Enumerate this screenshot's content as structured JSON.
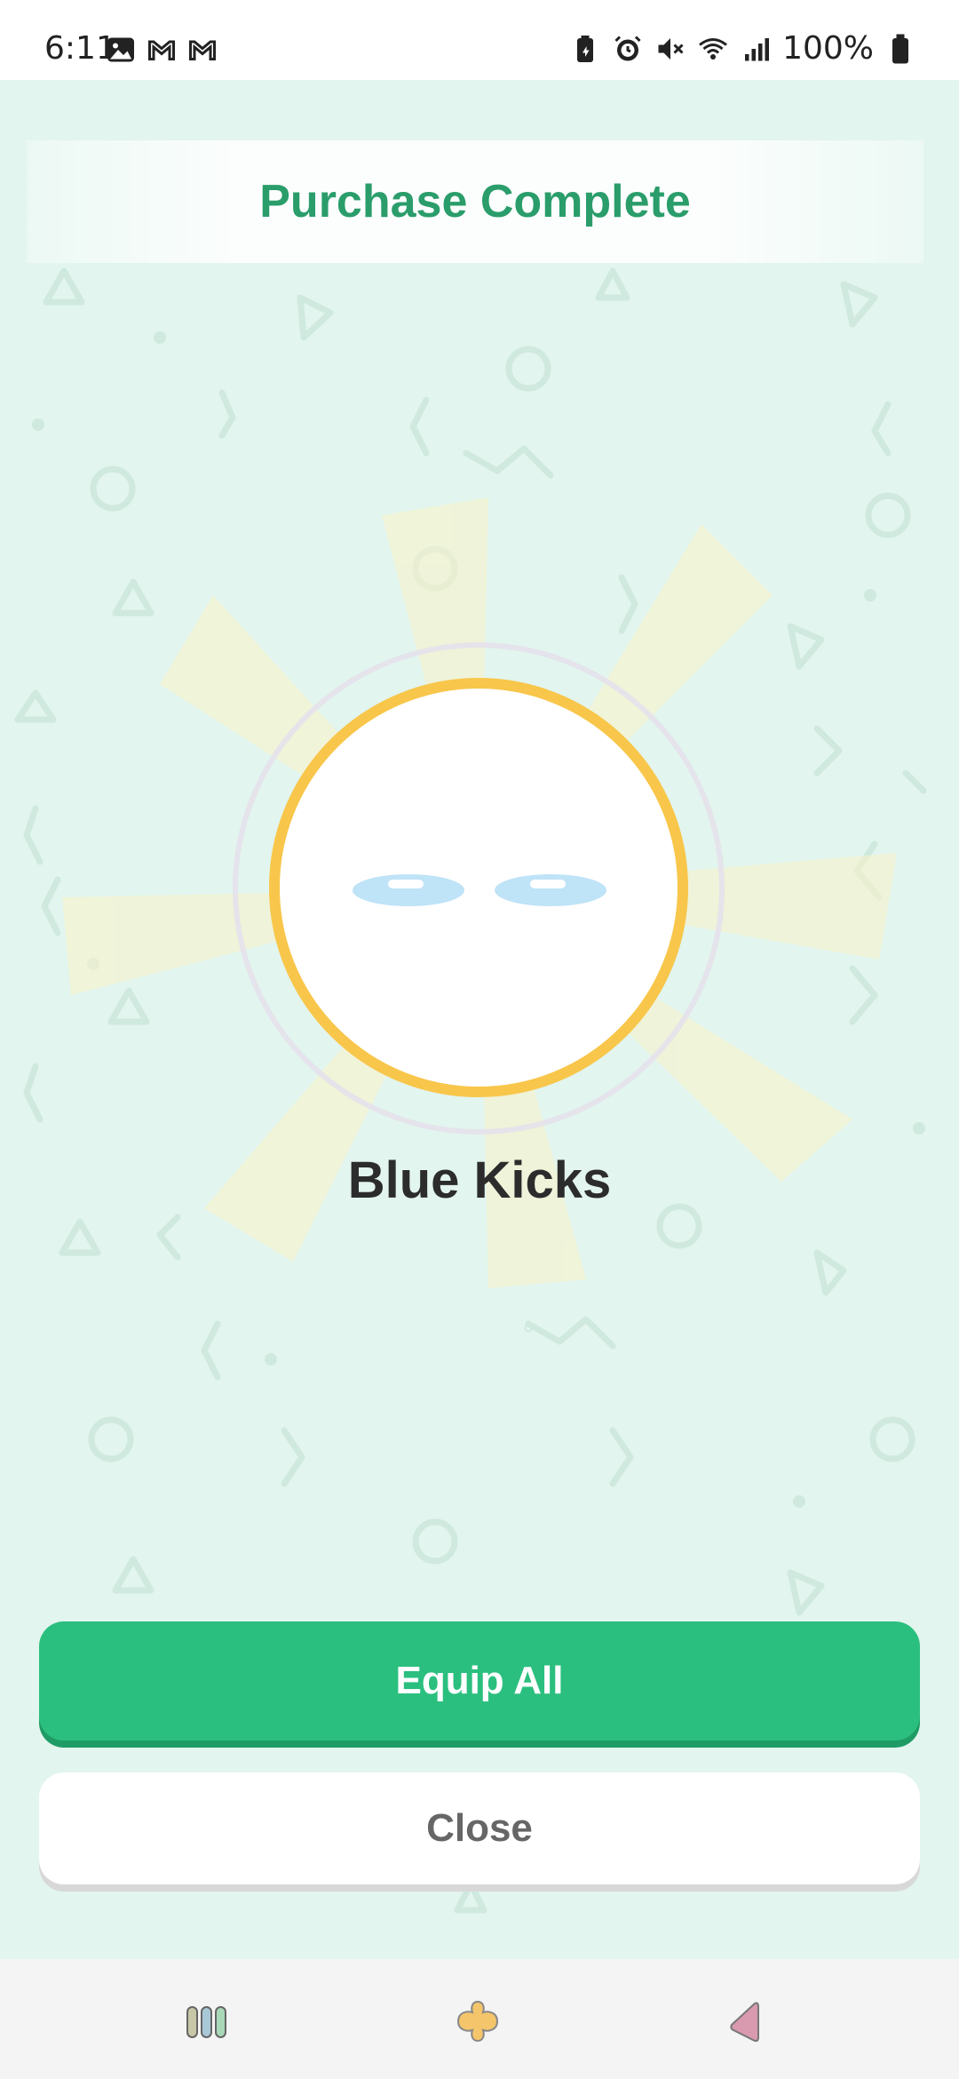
{
  "status_bar": {
    "time": "6:11",
    "battery": "100%",
    "left_icons": [
      "image-icon",
      "gmail-icon",
      "gmail-icon"
    ],
    "right_icons": [
      "battery-saver-icon",
      "alarm-icon",
      "mute-icon",
      "wifi-icon",
      "signal-icon",
      "battery-icon"
    ]
  },
  "header": {
    "title": "Purchase Complete"
  },
  "item": {
    "name": "Blue Kicks",
    "icon": "blue-shoes-icon"
  },
  "actions": {
    "equip_label": "Equip All",
    "close_label": "Close"
  },
  "nav_bar": {
    "icons": [
      "recent-apps-icon",
      "home-icon",
      "back-icon"
    ]
  },
  "colors": {
    "accent_green": "#2bbf7f",
    "title_green": "#2a9d6b",
    "ring_yellow": "#f8c64a",
    "background_mint": "#e2f5ee",
    "shoe_blue": "#bfe3f7"
  }
}
